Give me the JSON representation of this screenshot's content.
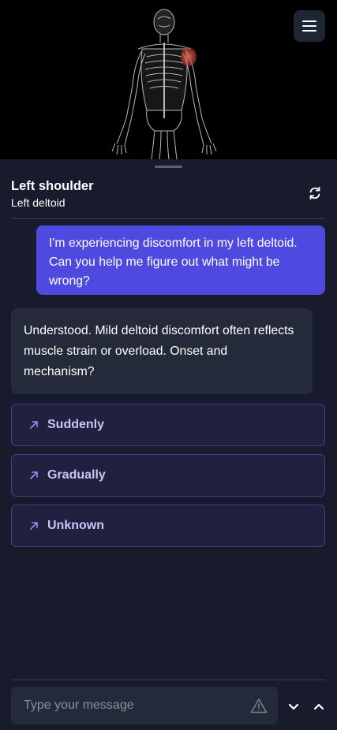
{
  "viewer": {
    "model_icon": "anatomy-skeleton-model",
    "highlight_color": "#e0443a"
  },
  "menu": {
    "icon": "hamburger-menu-icon"
  },
  "header": {
    "title": "Left shoulder",
    "subtitle": "Left deltoid",
    "refresh_icon": "refresh-icon"
  },
  "messages": {
    "user": "I'm experiencing discomfort in my left deltoid. Can you help me figure out what might be wrong?",
    "bot": "Understood. Mild deltoid discomfort often reflects muscle strain or overload. Onset and mechanism?"
  },
  "options": [
    {
      "label": "Suddenly"
    },
    {
      "label": "Gradually"
    },
    {
      "label": "Unknown"
    }
  ],
  "composer": {
    "placeholder": "Type your message",
    "warning_icon": "warning-triangle-icon"
  },
  "colors": {
    "accent": "#4f4adf",
    "option_border": "#3f4285",
    "option_text": "#c7c7f3"
  }
}
